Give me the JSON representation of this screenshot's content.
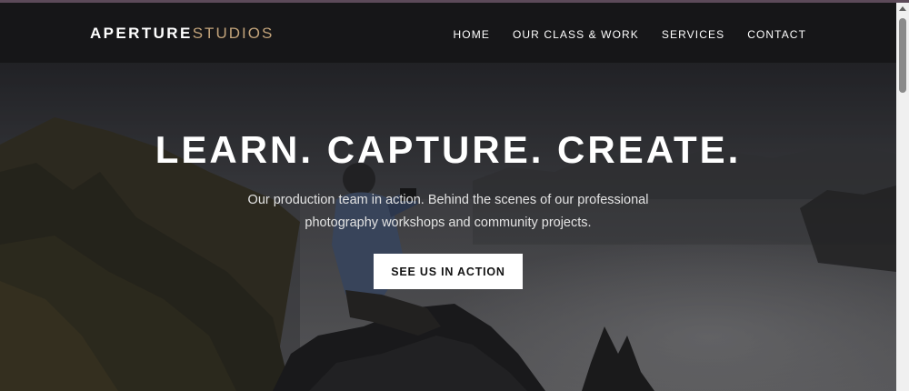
{
  "brand": {
    "strong": "APERTURE",
    "light": "STUDIOS"
  },
  "nav": {
    "items": [
      {
        "label": "HOME"
      },
      {
        "label": "OUR CLASS & WORK"
      },
      {
        "label": "SERVICES"
      },
      {
        "label": "CONTACT"
      }
    ]
  },
  "hero": {
    "title": "LEARN. CAPTURE. CREATE.",
    "subtitle_line1": "Our production team in action. Behind the scenes of our professional",
    "subtitle_line2": "photography workshops and community projects.",
    "cta_label": "SEE US IN ACTION"
  },
  "colors": {
    "navbar_bg": "#161618",
    "brand_accent": "#c2a37a",
    "text_primary": "#ffffff",
    "cta_bg": "#ffffff",
    "cta_text": "#141414"
  }
}
